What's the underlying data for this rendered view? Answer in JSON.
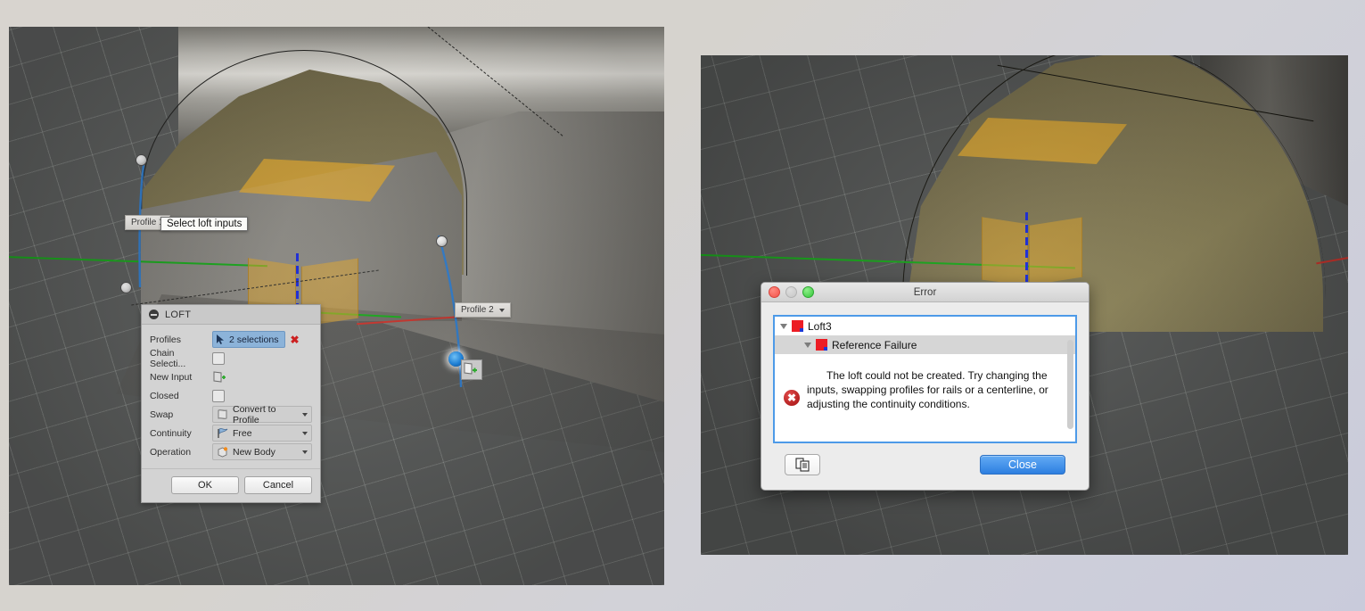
{
  "viewports": {
    "left": {
      "name": "3D modeling viewport (loft in progress)"
    },
    "right": {
      "name": "3D modeling viewport (error state)"
    }
  },
  "canvas_labels": {
    "profile_1": "Profile 1",
    "profile_2": "Profile 2",
    "tooltip": "Select loft inputs"
  },
  "loft_panel": {
    "title": "LOFT",
    "rows": [
      {
        "label": "Profiles",
        "type": "selection",
        "value": "2 selections"
      },
      {
        "label": "Chain Selecti...",
        "type": "checkbox",
        "value": ""
      },
      {
        "label": "New Input",
        "type": "icon",
        "value": ""
      },
      {
        "label": "Closed",
        "type": "checkbox",
        "value": ""
      },
      {
        "label": "Swap",
        "type": "dropdown",
        "value": "Convert to Profile"
      },
      {
        "label": "Continuity",
        "type": "dropdown",
        "value": "Free"
      },
      {
        "label": "Operation",
        "type": "dropdown",
        "value": "New Body"
      }
    ],
    "ok_label": "OK",
    "cancel_label": "Cancel"
  },
  "error_window": {
    "title": "Error",
    "tree": [
      {
        "label": "Loft3",
        "level": 0
      },
      {
        "label": "Reference Failure",
        "level": 1
      }
    ],
    "message": "The loft could not be created. Try changing the inputs, swapping profiles for rails or a centerline, or adjusting the continuity conditions.",
    "close_label": "Close"
  },
  "colors": {
    "accent_blue": "#2d7fe0",
    "selection_blue": "#8cb3d9",
    "error_red": "#ec1c24",
    "gold_surface": "#e7ac2d",
    "axis_green": "#17a81a",
    "axis_red": "#c8322a",
    "tree_border": "#4d9ae8"
  }
}
